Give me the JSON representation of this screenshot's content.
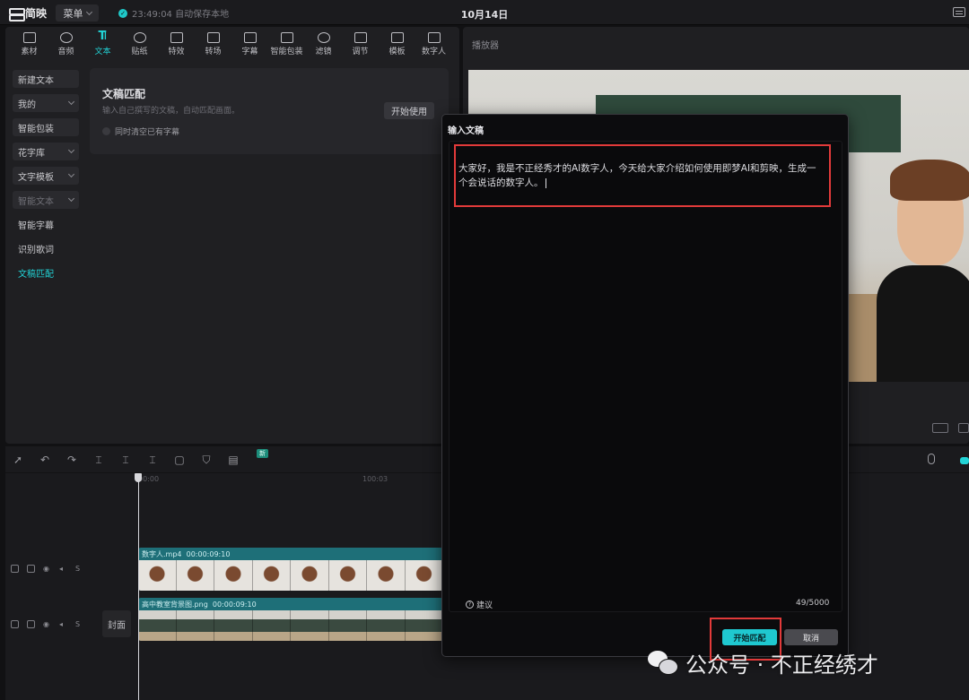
{
  "app": {
    "name": "简映",
    "menu_label": "菜单",
    "save_status": "23:49:04 自动保存本地",
    "title": "10月14日"
  },
  "toolbar": [
    {
      "label": "素材",
      "icon": "media-icon"
    },
    {
      "label": "音频",
      "icon": "audio-icon"
    },
    {
      "label": "文本",
      "icon": "text-icon",
      "active": true
    },
    {
      "label": "贴纸",
      "icon": "sticker-icon"
    },
    {
      "label": "特效",
      "icon": "effects-icon"
    },
    {
      "label": "转场",
      "icon": "transition-icon"
    },
    {
      "label": "字幕",
      "icon": "subtitle-icon"
    },
    {
      "label": "智能包装",
      "icon": "smart-pack-icon"
    },
    {
      "label": "滤镜",
      "icon": "filter-icon"
    },
    {
      "label": "调节",
      "icon": "adjust-icon"
    },
    {
      "label": "模板",
      "icon": "template-icon"
    },
    {
      "label": "数字人",
      "icon": "digital-human-icon"
    }
  ],
  "side_nav": [
    {
      "label": "新建文本",
      "type": "filled"
    },
    {
      "label": "我的",
      "type": "filled",
      "caret": true
    },
    {
      "label": "智能包装",
      "type": "filled"
    },
    {
      "label": "花字库",
      "type": "filled",
      "caret": true
    },
    {
      "label": "文字模板",
      "type": "filled",
      "caret": true
    },
    {
      "label": "智能文本",
      "type": "filled-dim",
      "caret": true
    },
    {
      "label": "智能字幕",
      "type": "plain"
    },
    {
      "label": "识别歌词",
      "type": "plain"
    },
    {
      "label": "文稿匹配",
      "type": "teal"
    }
  ],
  "match_card": {
    "title": "文稿匹配",
    "desc": "输入自己撰写的文稿，自动匹配画面。",
    "button": "开始使用",
    "checkbox": "同时清空已有字幕"
  },
  "player": {
    "title": "播放器"
  },
  "timeline": {
    "badge": "新",
    "ruler_0": "00:00",
    "ruler_1": "100:03",
    "cover_label": "封面",
    "clips": [
      {
        "name": "数字人.mp4",
        "duration": "00:00:09:10"
      },
      {
        "name": "高中教室背景图.png",
        "duration": "00:00:09:10"
      }
    ]
  },
  "modal": {
    "title": "输入文稿",
    "script": "大家好，我是不正经秀才的AI数字人，今天给大家介绍如何使用即梦AI和剪映，生成一个会说话的数字人。",
    "suggest": "建议",
    "counter": "49/5000",
    "primary": "开始匹配",
    "cancel": "取消"
  },
  "watermark": "公众号 · 不正经绣才",
  "colors": {
    "accent": "#1fc8d0",
    "highlight": "#e23a3a",
    "bg": "#111113"
  }
}
